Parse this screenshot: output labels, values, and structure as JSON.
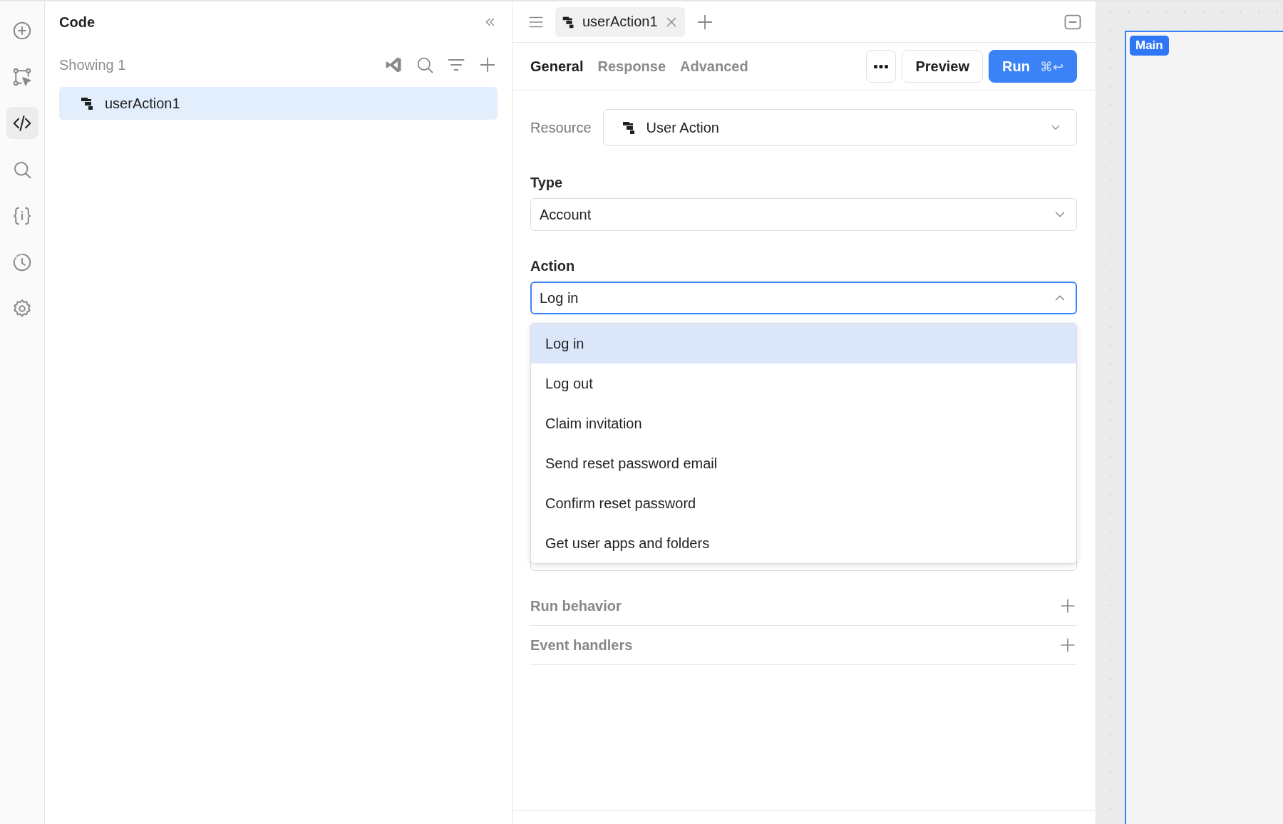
{
  "rail": {
    "items": [
      {
        "kind": "add",
        "selected": false
      },
      {
        "kind": "select",
        "selected": false
      },
      {
        "kind": "code",
        "selected": true
      },
      {
        "kind": "search",
        "selected": false
      },
      {
        "kind": "state",
        "selected": false
      },
      {
        "kind": "history",
        "selected": false
      },
      {
        "kind": "settings",
        "selected": false
      }
    ]
  },
  "code_panel": {
    "title": "Code",
    "count": "Showing 1",
    "items": [
      {
        "label": "userAction1",
        "selected": true
      }
    ]
  },
  "editor": {
    "tabs": [
      {
        "label": "userAction1",
        "selected": true
      }
    ],
    "section_tabs": [
      {
        "label": "General",
        "selected": true
      },
      {
        "label": "Response",
        "selected": false
      },
      {
        "label": "Advanced",
        "selected": false
      }
    ],
    "preview_button": "Preview",
    "run_button": {
      "label": "Run",
      "shortcut": "⌘↩"
    },
    "resource": {
      "label": "Resource",
      "value": "User Action"
    },
    "type": {
      "label": "Type",
      "value": "Account"
    },
    "action": {
      "label": "Action",
      "value": "Log in",
      "expanded": true,
      "options": [
        {
          "label": "Log in",
          "selected": true
        },
        {
          "label": "Log out",
          "selected": false
        },
        {
          "label": "Claim invitation",
          "selected": false
        },
        {
          "label": "Send reset password email",
          "selected": false
        },
        {
          "label": "Confirm reset password",
          "selected": false
        },
        {
          "label": "Get user apps and folders",
          "selected": false
        }
      ]
    },
    "sections": [
      {
        "label": "Run behavior",
        "expanded": false
      },
      {
        "label": "Event handlers",
        "expanded": false
      }
    ]
  },
  "canvas": {
    "frame_label": "Main"
  }
}
